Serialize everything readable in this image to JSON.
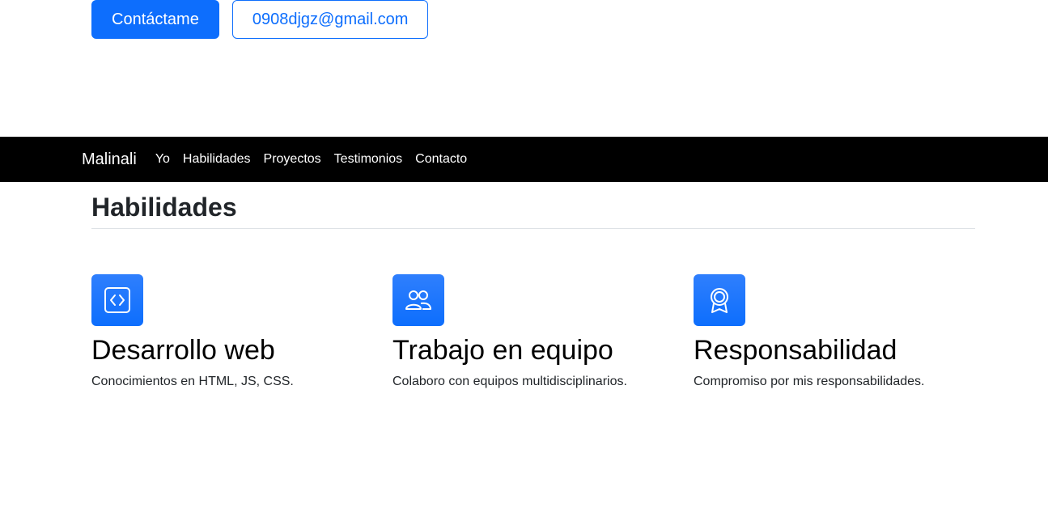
{
  "hero": {
    "contact_button": "Contáctame",
    "email_button": "0908djgz@gmail.com"
  },
  "navbar": {
    "brand": "Malinali",
    "links": [
      "Yo",
      "Habilidades",
      "Proyectos",
      "Testimonios",
      "Contacto"
    ]
  },
  "skills": {
    "title": "Habilidades",
    "items": [
      {
        "icon": "code-square-icon",
        "title": "Desarrollo web",
        "text": "Conocimientos en HTML, JS, CSS."
      },
      {
        "icon": "people-icon",
        "title": "Trabajo en equipo",
        "text": "Colaboro con equipos multidisciplinarios."
      },
      {
        "icon": "award-icon",
        "title": "Responsabilidad",
        "text": "Compromiso por mis responsabilidades."
      }
    ]
  },
  "colors": {
    "primary": "#0d6efd",
    "navbar_bg": "#000000"
  }
}
